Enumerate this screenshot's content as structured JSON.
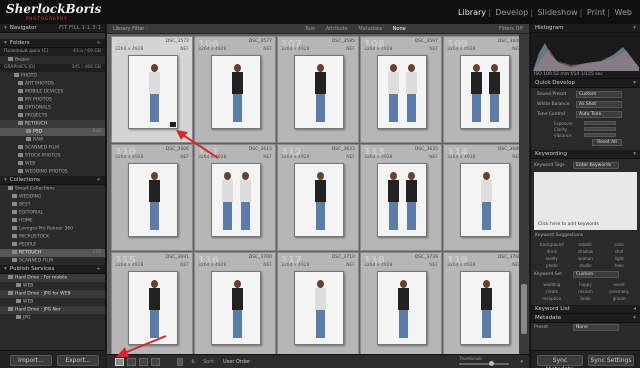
{
  "logo": {
    "main": "SherlockBoris",
    "sub": "PHOTOGRAPHY"
  },
  "modules": [
    {
      "label": "Library",
      "active": true
    },
    {
      "label": "Develop"
    },
    {
      "label": "Slideshow"
    },
    {
      "label": "Print"
    },
    {
      "label": "Web"
    }
  ],
  "navigator": {
    "title": "Navigator",
    "modes": "FIT  FILL  1:1  3:1"
  },
  "folders": {
    "title": "Folders",
    "volume1": {
      "label": "Полезный диск (C)",
      "info": "43.a / 69 GB"
    },
    "volume2": {
      "label": "GRAPHICS (D)",
      "info": "345 / 468 GB"
    },
    "rows": [
      {
        "label": "Видео",
        "count": ""
      },
      {
        "label": "PHOTO",
        "count": ""
      },
      {
        "label": "ART PHOTOS",
        "count": ""
      },
      {
        "label": "MOBILE DEVICES",
        "count": ""
      },
      {
        "label": "MY PHOTOS",
        "count": ""
      },
      {
        "label": "OPTIONALS",
        "count": ""
      },
      {
        "label": "PROJECTS",
        "count": ""
      },
      {
        "label": "RETOUCH",
        "count": ""
      },
      {
        "label": "PSD",
        "count": "330"
      },
      {
        "label": "RAW",
        "count": ""
      },
      {
        "label": "SCANNED FILM",
        "count": ""
      },
      {
        "label": "STOCK PHOTOS",
        "count": ""
      },
      {
        "label": "WEB",
        "count": ""
      },
      {
        "label": "WEDDING PHOTOS",
        "count": ""
      }
    ]
  },
  "collections": {
    "title": "Collections",
    "rows": [
      {
        "label": "Smart Collections",
        "count": ""
      },
      {
        "label": "WEDDING",
        "count": ""
      },
      {
        "label": "BEST",
        "count": ""
      },
      {
        "label": "EDITORIAL",
        "count": ""
      },
      {
        "label": "HOME",
        "count": ""
      },
      {
        "label": "Lovegro Pro Runner 360",
        "count": ""
      },
      {
        "label": "MICROSTOCK",
        "count": ""
      },
      {
        "label": "PEOPLE",
        "count": ""
      },
      {
        "label": "RETOUCH",
        "count": "125"
      },
      {
        "label": "SCANNED FILM",
        "count": ""
      }
    ]
  },
  "publish": {
    "title": "Publish Services",
    "rows": [
      {
        "label": "Hard Drive : For mobile",
        "count": ""
      },
      {
        "label": "WEB",
        "count": ""
      },
      {
        "label": "Hard Drive : JPG for WEB",
        "count": ""
      },
      {
        "label": "WEB",
        "count": ""
      },
      {
        "label": "Hard Drive : JPG Nor",
        "count": ""
      },
      {
        "label": "JPG",
        "count": ""
      }
    ]
  },
  "left_buttons": {
    "import": "Import...",
    "export": "Export..."
  },
  "filter": {
    "title": "Library Filter :",
    "tabs": [
      {
        "label": "Text"
      },
      {
        "label": "Attribute"
      },
      {
        "label": "Metadata"
      },
      {
        "label": "None",
        "active": true
      }
    ],
    "filters_off": "Filters Off"
  },
  "cells": [
    {
      "idx": "105",
      "file": "DSC_3572",
      "dims": "3264 x 4928",
      "fmt": "NEF",
      "selected": true
    },
    {
      "idx": "106",
      "file": "DSC_3577",
      "dims": "3264 x 4928",
      "fmt": "NEF"
    },
    {
      "idx": "107",
      "file": "DSC_3585",
      "dims": "3264 x 4928",
      "fmt": "NEF"
    },
    {
      "idx": "108",
      "file": "DSC_3597",
      "dims": "3264 x 4928",
      "fmt": "NEF"
    },
    {
      "idx": "109",
      "file": "DSC_3600",
      "dims": "3264 x 4928",
      "fmt": "NEF"
    },
    {
      "idx": "110",
      "file": "DSC_3606",
      "dims": "3264 x 4928",
      "fmt": "NEF"
    },
    {
      "idx": "111",
      "file": "DSC_3615",
      "dims": "3264 x 4928",
      "fmt": "NEF"
    },
    {
      "idx": "112",
      "file": "DSC_3623",
      "dims": "3264 x 4928",
      "fmt": "NEF"
    },
    {
      "idx": "113",
      "file": "DSC_3635",
      "dims": "3264 x 4928",
      "fmt": "NEF"
    },
    {
      "idx": "114",
      "file": "DSC_3688",
      "dims": "3264 x 4928",
      "fmt": "NEF"
    },
    {
      "idx": "115",
      "file": "DSC_3691",
      "dims": "3264 x 4928",
      "fmt": "NEF"
    },
    {
      "idx": "116",
      "file": "DSC_3700",
      "dims": "3264 x 4928",
      "fmt": "NEF"
    },
    {
      "idx": "117",
      "file": "DSC_3710",
      "dims": "3264 x 4928",
      "fmt": "NEF"
    },
    {
      "idx": "118",
      "file": "DSC_3739",
      "dims": "3264 x 4928",
      "fmt": "NEF"
    },
    {
      "idx": "119",
      "file": "DSC_3760",
      "dims": "3264 x 4928",
      "fmt": "NEF"
    }
  ],
  "toolbar": {
    "sort_label": "Sort:",
    "sort_value": "User Order",
    "thumbs_label": "Thumbnails"
  },
  "histogram": {
    "title": "Histogram",
    "info": "ISO 100   52 mm   f/14   1/125 sec"
  },
  "quick_develop": {
    "title": "Quick Develop",
    "saved_preset": {
      "label": "Saved Preset",
      "value": "Custom"
    },
    "white_balance": {
      "label": "White Balance",
      "value": "As Shot"
    },
    "tone_control": {
      "label": "Tone Control",
      "value": "Auto Tone"
    },
    "sliders": [
      "Exposure",
      "Clarity",
      "Vibrance"
    ],
    "reset": "Reset All"
  },
  "keywording": {
    "title": "Keywording",
    "tags_label": "Keyword Tags",
    "tags_value": "Enter Keywords",
    "hint": "Click here to add keywords",
    "suggestions_title": "Keyword Suggestions",
    "suggestions": [
      "background",
      "robotic",
      "color",
      "drink",
      "shadow",
      "shot",
      "lovely",
      "woman",
      "light",
      "photo",
      "studio",
      "teen"
    ],
    "set_label": "Keyword Set",
    "set_value": "Custom",
    "set_items": [
      "wedding",
      "happy",
      "event",
      "cream",
      "realism",
      "ceremony",
      "reception",
      "bride",
      "groom"
    ]
  },
  "keyword_list": {
    "title": "Keyword List"
  },
  "metadata": {
    "title": "Metadata",
    "preset_label": "Preset",
    "preset_value": "None"
  },
  "right_buttons": {
    "sync_meta": "Sync Metadata",
    "sync_settings": "Sync Settings"
  },
  "colors": {
    "annotation": "#d42a2a",
    "panel": "#2a2a2a",
    "grid": "#606060"
  }
}
